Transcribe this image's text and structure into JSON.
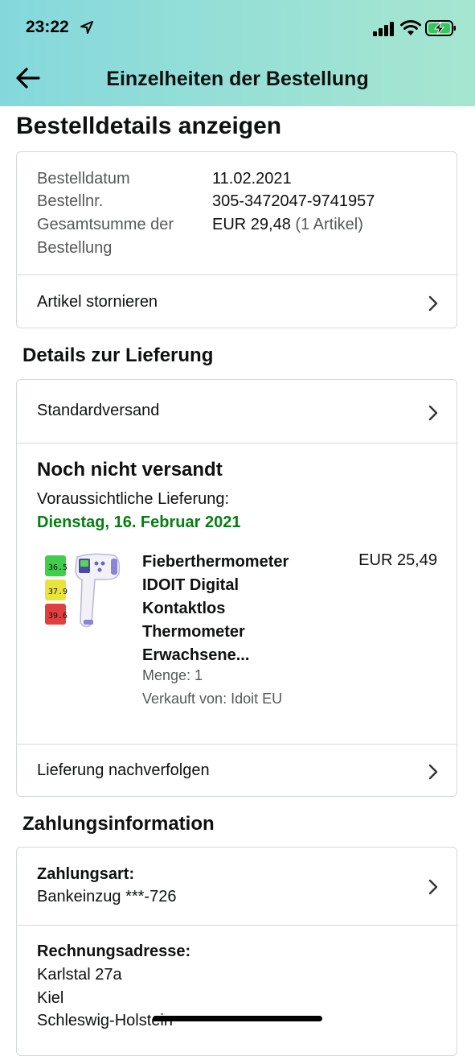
{
  "status_bar": {
    "time": "23:22"
  },
  "header": {
    "title": "Einzelheiten der Bestellung"
  },
  "page_title": "Bestelldetails anzeigen",
  "order_summary": {
    "date_label": "Bestelldatum",
    "date_value": "11.02.2021",
    "number_label": "Bestellnr.",
    "number_value": "305-3472047-9741957",
    "total_label_line1": "Gesamtsumme der",
    "total_label_line2": "Bestellung",
    "total_value": "EUR 29,48",
    "total_items": "(1 Artikel)",
    "cancel_label": "Artikel stornieren"
  },
  "delivery": {
    "section_title": "Details zur Lieferung",
    "shipping_method": "Standardversand",
    "status": "Noch nicht versandt",
    "expected_label": "Voraussichtliche Lieferung:",
    "expected_date": "Dienstag, 16. Februar 2021",
    "product": {
      "title_lines": [
        "Fieberthermometer",
        "IDOIT Digital",
        "Kontaktlos",
        "Thermometer",
        "Erwachsene..."
      ],
      "price": "EUR 25,49",
      "quantity": "Menge: 1",
      "seller": "Verkauft von: Idoit EU",
      "image_readings": [
        "36.5",
        "37.9",
        "39.6"
      ]
    },
    "track_label": "Lieferung nachverfolgen"
  },
  "payment": {
    "section_title": "Zahlungsinformation",
    "method_label": "Zahlungsart:",
    "method_value": "Bankeinzug ***-726",
    "billing_label": "Rechnungsadresse:",
    "address_lines": [
      "Karlstal 27a",
      "Kiel",
      "Schleswig-Holstein"
    ]
  },
  "colors": {
    "header_gradient_start": "#84d8dc",
    "header_gradient_end": "#a6e6d0",
    "delivery_date_green": "#067d12",
    "border": "#d5d9d9",
    "muted_text": "#565959"
  },
  "icons": [
    "location-arrow-icon",
    "signal-icon",
    "wifi-icon",
    "battery-charging-icon",
    "back-arrow-icon",
    "chevron-right-icon"
  ]
}
